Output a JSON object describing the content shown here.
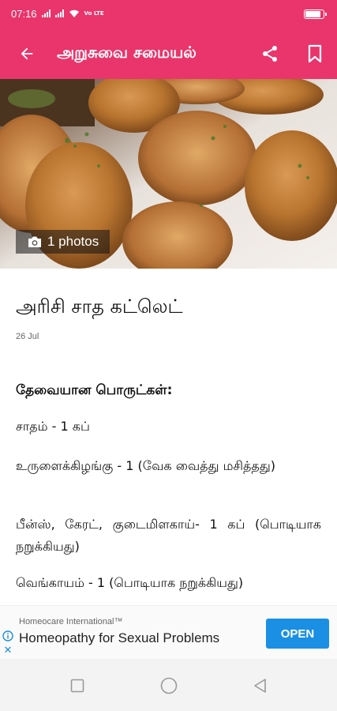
{
  "status_bar": {
    "time": "07:16",
    "network_label": "Vo LTE",
    "battery_level": 0.85
  },
  "app_bar": {
    "title": "அறுசுவை சமையல்",
    "back_icon": "arrow-left-icon",
    "share_icon": "share-icon",
    "bookmark_icon": "bookmark-icon"
  },
  "hero": {
    "photo_count_label": "1 photos",
    "camera_icon": "camera-icon"
  },
  "recipe": {
    "title": "அரிசி சாத கட்லெட்",
    "date": "26 Jul",
    "ingredients_heading": "தேவையான பொருட்கள்:",
    "ingredients": [
      "சாதம் - 1 கப்",
      "உருளைக்கிழங்கு - 1 (வேக வைத்து மசித்தது)",
      "பீன்ஸ், கேரட், குடைமிளகாய்- 1 கப் (பொடியாக நறுக்கியது)",
      "வெங்காயம் - 1 (பொடியாக நறுக்கியது)"
    ]
  },
  "ad": {
    "advertiser": "Homeocare International™",
    "headline": "Homeopathy for Sexual Problems",
    "cta": "OPEN",
    "accent_color": "#1a8fe3"
  },
  "nav_bar": {
    "recent_icon": "square-icon",
    "home_icon": "circle-icon",
    "back_icon": "triangle-back-icon"
  },
  "theme": {
    "primary": "#e9356c"
  }
}
